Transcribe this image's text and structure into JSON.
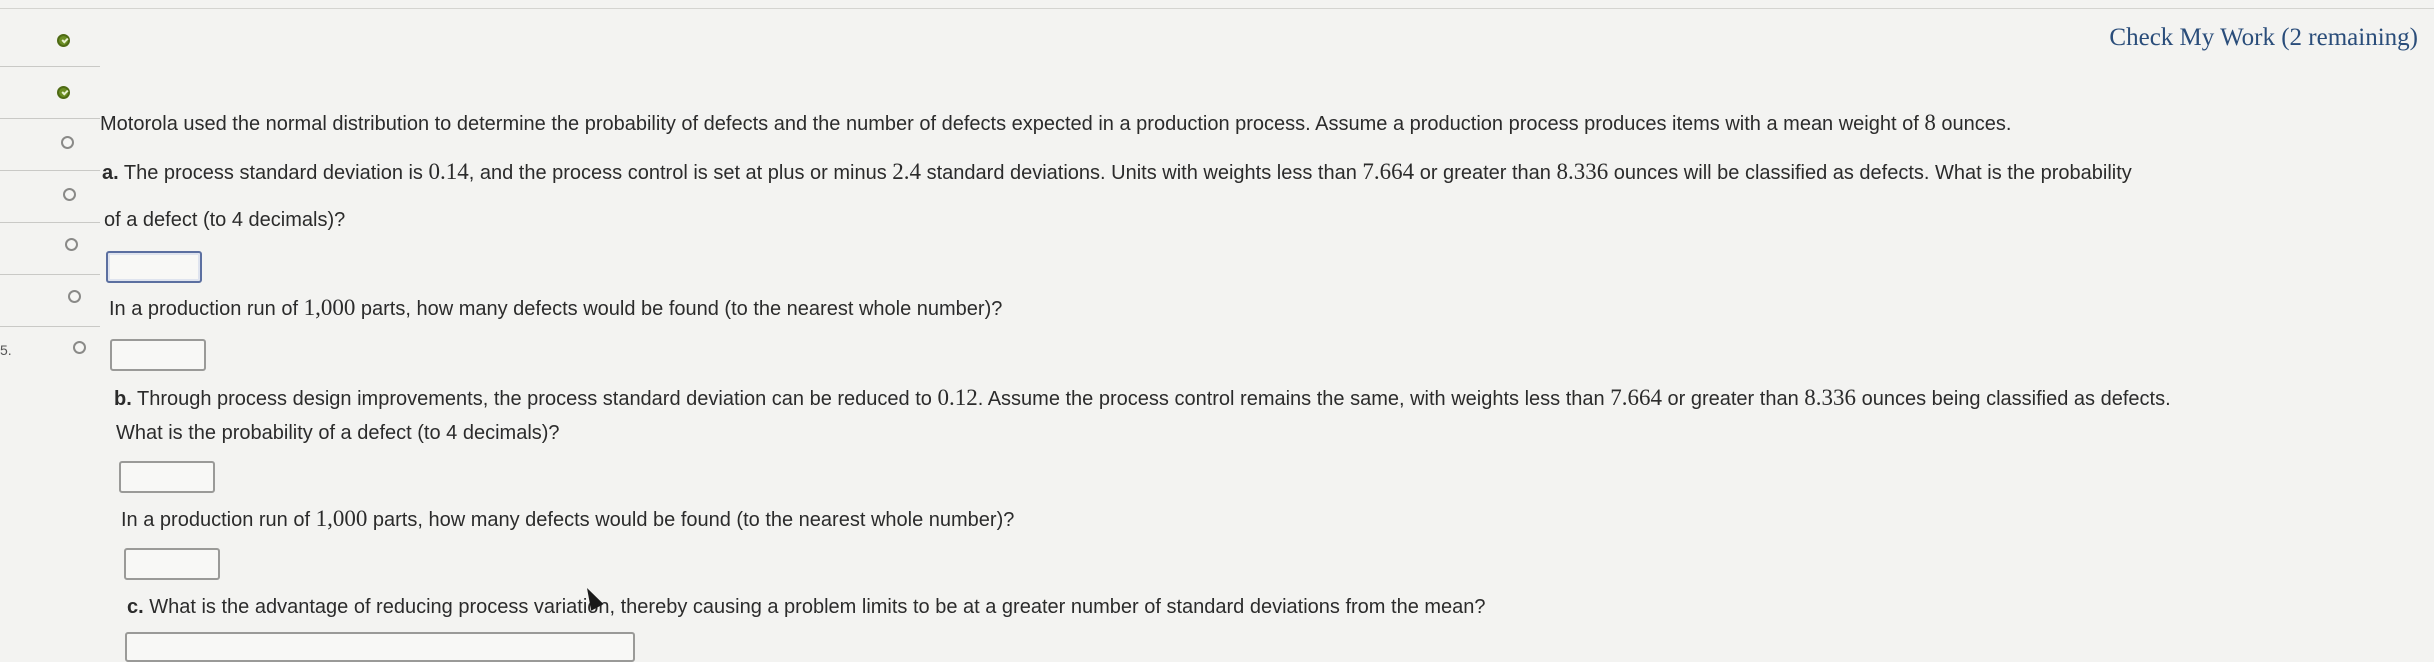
{
  "header": {
    "check_my_work": "Check My Work (2 remaining)"
  },
  "nav": {
    "items": [
      {
        "status": "complete"
      },
      {
        "status": "complete"
      },
      {
        "status": "open"
      },
      {
        "status": "open"
      },
      {
        "status": "open"
      },
      {
        "status": "open"
      },
      {
        "status": "open"
      }
    ],
    "edge_mark": "5."
  },
  "problem": {
    "intro_pre": "Motorola used the normal distribution to determine the probability of defects and the number of defects expected in a production process. Assume a production process produces items with a mean weight of ",
    "intro_mean": "8",
    "intro_post": " ounces.",
    "part_a": {
      "label": "a.",
      "line1_pre": " The process standard deviation is ",
      "sd": "0.14",
      "line1_mid1": ", and the process control is set at plus or minus ",
      "k": "2.4",
      "line1_mid2": " standard deviations. Units with weights less than ",
      "low": "7.664",
      "line1_mid3": " or greater than ",
      "high": "8.336",
      "line1_post": " ounces will be classified as defects. What is the probability",
      "line2": "of a defect (to 4 decimals)?",
      "q2_pre": "In a production run of ",
      "run": "1,000",
      "q2_post": " parts, how many defects would be found (to the nearest whole number)?"
    },
    "part_b": {
      "label": "b.",
      "line1_pre": " Through process design improvements, the process standard deviation can be reduced to ",
      "sd": "0.12",
      "line1_mid1": ". Assume the process control remains the same, with weights less than ",
      "low": "7.664",
      "line1_mid2": " or greater than ",
      "high": "8.336",
      "line1_post": " ounces being classified as defects.",
      "line2": "What is the probability of a defect (to 4 decimals)?",
      "q2_pre": "In a production run of ",
      "run": "1,000",
      "q2_post": " parts, how many defects would be found (to the nearest whole number)?"
    },
    "part_c": {
      "label": "c.",
      "text": " What is the advantage of reducing process variation, thereby causing a problem limits to be at a greater number of standard deviations from the mean?"
    }
  }
}
